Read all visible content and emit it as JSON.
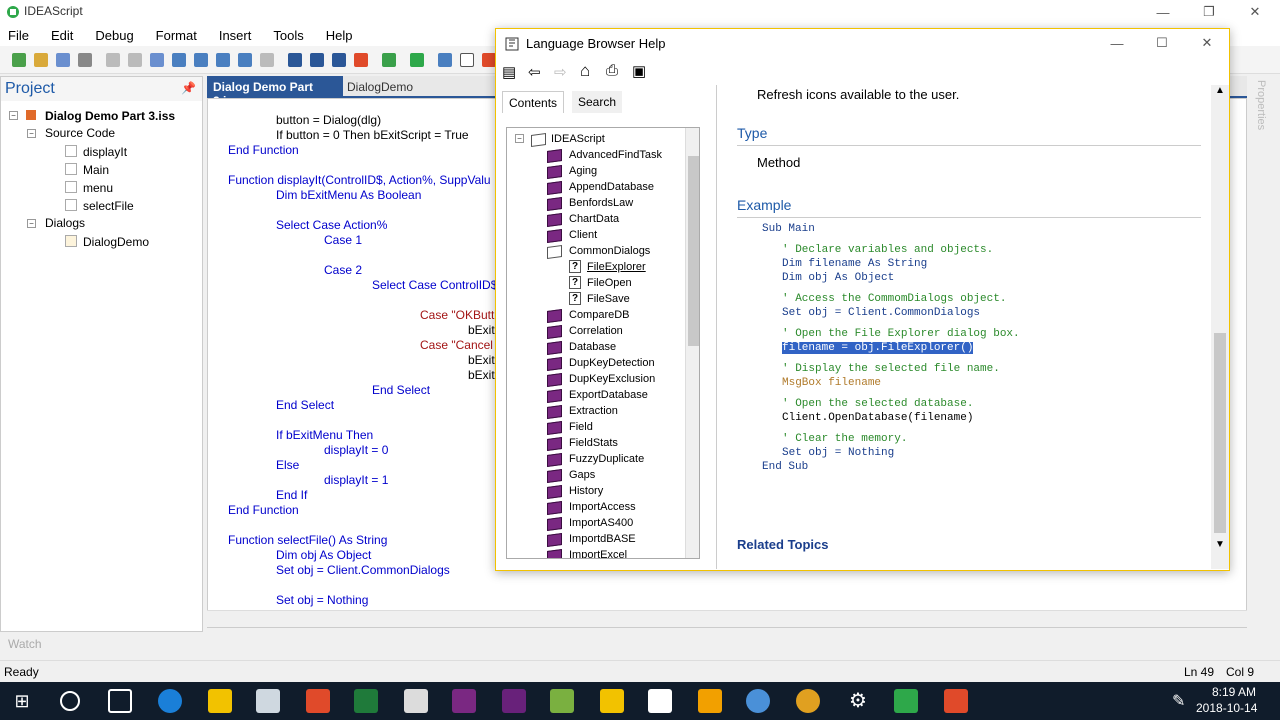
{
  "app": {
    "title": "IDEAScript"
  },
  "menu": [
    "File",
    "Edit",
    "Debug",
    "Format",
    "Insert",
    "Tools",
    "Help"
  ],
  "project": {
    "title": "Project",
    "root": "Dialog Demo Part 3.iss",
    "source_code": "Source Code",
    "files": [
      "displayIt",
      "Main",
      "menu",
      "selectFile"
    ],
    "dialogs": "Dialogs",
    "dialog_items": [
      "DialogDemo"
    ]
  },
  "tabs": {
    "active": "Dialog Demo Part 3.iss",
    "second": "DialogDemo"
  },
  "code": {
    "l1": "button = Dialog(dlg)",
    "l2": "If button = 0 Then bExitScript = True",
    "l3": "End Function",
    "l4": "Function displayIt(ControlID$, Action%, SuppValu",
    "l5": "Dim bExitMenu As Boolean",
    "l6": "Select Case Action%",
    "l7": "Case 1",
    "l8": "Case 2",
    "l9": "Select Case ControlID$",
    "l10": "Case \"OKButt",
    "l11": "bExitI",
    "l12": "Case \"Cancel",
    "l13": "bExitI",
    "l14": "bExitS",
    "l15": "End Select",
    "l16": "End Select",
    "l17": "If bExitMenu Then",
    "l18": "displayIt = 0",
    "l19": "Else",
    "l20": "displayIt = 1",
    "l21": "End If",
    "l22": "End Function",
    "l23": "Function selectFile() As String",
    "l24": "Dim obj As Object",
    "l25": "Set obj = Client.CommonDialogs",
    "l26": "Set obj = Nothing"
  },
  "watch_label": "Watch",
  "status": {
    "text": "Ready",
    "ln": "Ln 49",
    "col": "Col 9"
  },
  "side_label": "Properties",
  "help": {
    "title": "Language Browser Help",
    "tab_contents": "Contents",
    "tab_search": "Search",
    "tree_root": "IDEAScript",
    "tree": [
      "AdvancedFindTask",
      "Aging",
      "AppendDatabase",
      "BenfordsLaw",
      "ChartData",
      "Client",
      "CommonDialogs"
    ],
    "tree_children": [
      "FileExplorer",
      "FileOpen",
      "FileSave"
    ],
    "tree_more": [
      "CompareDB",
      "Correlation",
      "Database",
      "DupKeyDetection",
      "DupKeyExclusion",
      "ExportDatabase",
      "Extraction",
      "Field",
      "FieldStats",
      "FuzzyDuplicate",
      "Gaps",
      "History",
      "ImportAccess",
      "ImportAS400",
      "ImportdBASE",
      "ImportExcel"
    ],
    "content": {
      "intro": "Refresh icons available to the user.",
      "type_h": "Type",
      "type_v": "Method",
      "example_h": "Example",
      "c1": "Sub Main",
      "c2": "' Declare variables and objects.",
      "c3": "Dim filename As String",
      "c4": "Dim obj As Object",
      "c5": "' Access the CommomDialogs object.",
      "c6": "Set obj = Client.CommonDialogs",
      "c7": "' Open the File Explorer dialog box.",
      "c8": "filename = obj.FileExplorer()",
      "c9": "' Display the selected file name.",
      "c10": "MsgBox filename",
      "c11": "' Open the selected database.",
      "c12": "Client.OpenDatabase(filename)",
      "c13": "' Clear the memory.",
      "c14": "Set obj = Nothing",
      "c15": "End Sub",
      "related": "Related Topics"
    }
  },
  "clock": {
    "time": "8:19 AM",
    "date": "2018-10-14"
  }
}
